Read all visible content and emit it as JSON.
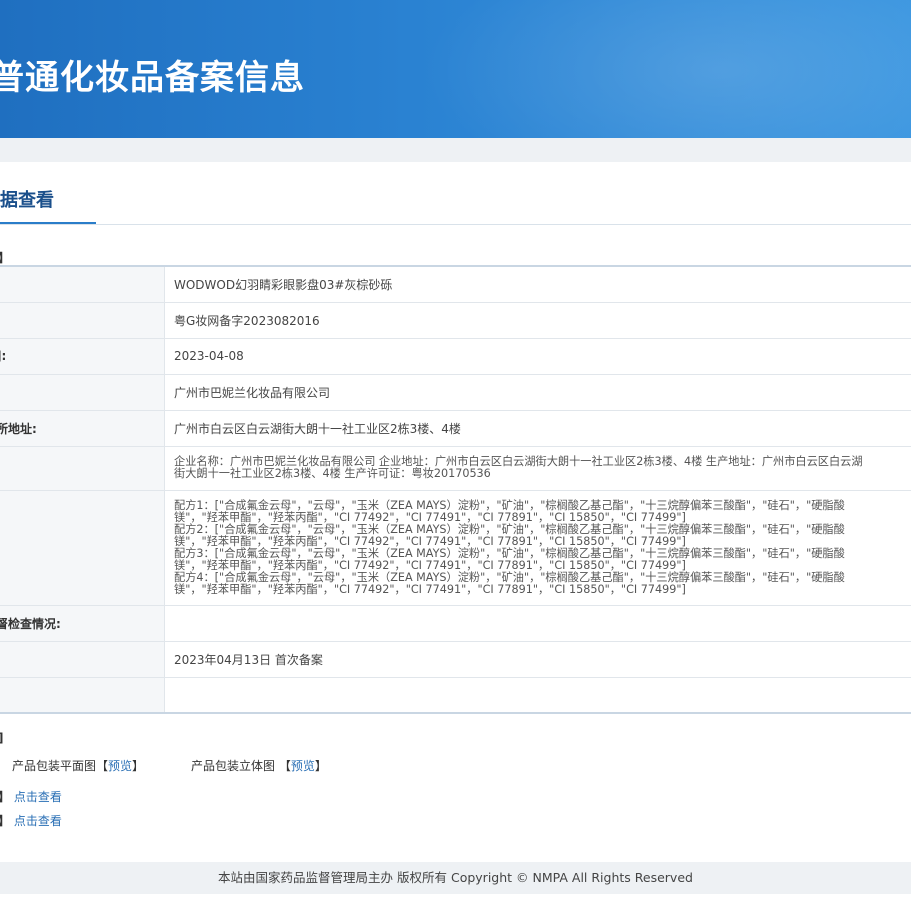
{
  "banner": {
    "title": "普通化妆品备案信息"
  },
  "tab": {
    "label": "据查看"
  },
  "section": {
    "heading": "】"
  },
  "rows": [
    {
      "label": ":",
      "value": "WODWOD幻羽睛彩眼影盘03#灰棕砂砾"
    },
    {
      "label": ":",
      "value": "粤G妆网备字2023082016"
    },
    {
      "label": "]:",
      "value": "2023-04-08"
    },
    {
      "label": "",
      "value": "广州市巴妮兰化妆品有限公司"
    },
    {
      "label": "所地址:",
      "value": "广州市白云区白云湖街大朗十一社工业区2栋3楼、4楼"
    },
    {
      "label": ":",
      "lines": [
        "企业名称：广州市巴妮兰化妆品有限公司 企业地址：广州市白云区白云湖街大朗十一社工业区2栋3楼、4楼 生产地址：广州市白云区白云湖",
        "街大朗十一社工业区2栋3楼、4楼 生产许可证：粤妆20170536"
      ]
    },
    {
      "label": "",
      "lines": [
        "配方1：[\"合成氟金云母\"，\"云母\"，\"玉米（ZEA MAYS）淀粉\"，\"矿油\"，\"棕榈酸乙基己酯\"，\"十三烷醇偏苯三酸酯\"，\"硅石\"，\"硬脂酸",
        "镁\"，\"羟苯甲酯\"，\"羟苯丙酯\"，\"CI 77492\"，\"CI 77491\"，\"CI 77891\"，\"CI 15850\"，\"CI 77499\"]",
        "配方2：[\"合成氟金云母\"，\"云母\"，\"玉米（ZEA MAYS）淀粉\"，\"矿油\"，\"棕榈酸乙基己酯\"，\"十三烷醇偏苯三酸酯\"，\"硅石\"，\"硬脂酸",
        "镁\"，\"羟苯甲酯\"，\"羟苯丙酯\"，\"CI 77492\"，\"CI 77491\"，\"CI 77891\"，\"CI 15850\"，\"CI 77499\"]",
        "配方3：[\"合成氟金云母\"，\"云母\"，\"玉米（ZEA MAYS）淀粉\"，\"矿油\"，\"棕榈酸乙基己酯\"，\"十三烷醇偏苯三酸酯\"，\"硅石\"，\"硬脂酸",
        "镁\"，\"羟苯甲酯\"，\"羟苯丙酯\"，\"CI 77492\"，\"CI 77491\"，\"CI 77891\"，\"CI 15850\"，\"CI 77499\"]",
        "配方4：[\"合成氟金云母\"，\"云母\"，\"玉米（ZEA MAYS）淀粉\"，\"矿油\"，\"棕榈酸乙基己酯\"，\"十三烷醇偏苯三酸酯\"，\"硅石\"，\"硬脂酸",
        "镁\"，\"羟苯甲酯\"，\"羟苯丙酯\"，\"CI 77492\"，\"CI 77491\"，\"CI 77891\"，\"CI 15850\"，\"CI 77499\"]"
      ]
    },
    {
      "label": "督检查情况:",
      "value": ""
    },
    {
      "label": ":",
      "value": "2023年04月13日 首次备案"
    },
    {
      "label": "",
      "value": ""
    }
  ],
  "attachments": {
    "images_head": "]",
    "flat_label": "产品包装平面图",
    "flat_link": "预览",
    "solid_label": "产品包装立体图",
    "solid_link": "预览",
    "row2_head": "】",
    "row2_link": "点击查看",
    "row3_head": "】",
    "row3_link": "点击查看",
    "bracket_open": "【",
    "bracket_close": "】"
  },
  "footer": {
    "text": "本站由国家药品监督管理局主办 版权所有 Copyright © NMPA All Rights Reserved"
  },
  "colors": {
    "banner": "#2a82d2",
    "link": "#2a6fb5",
    "tab": "#1a4f8b"
  }
}
